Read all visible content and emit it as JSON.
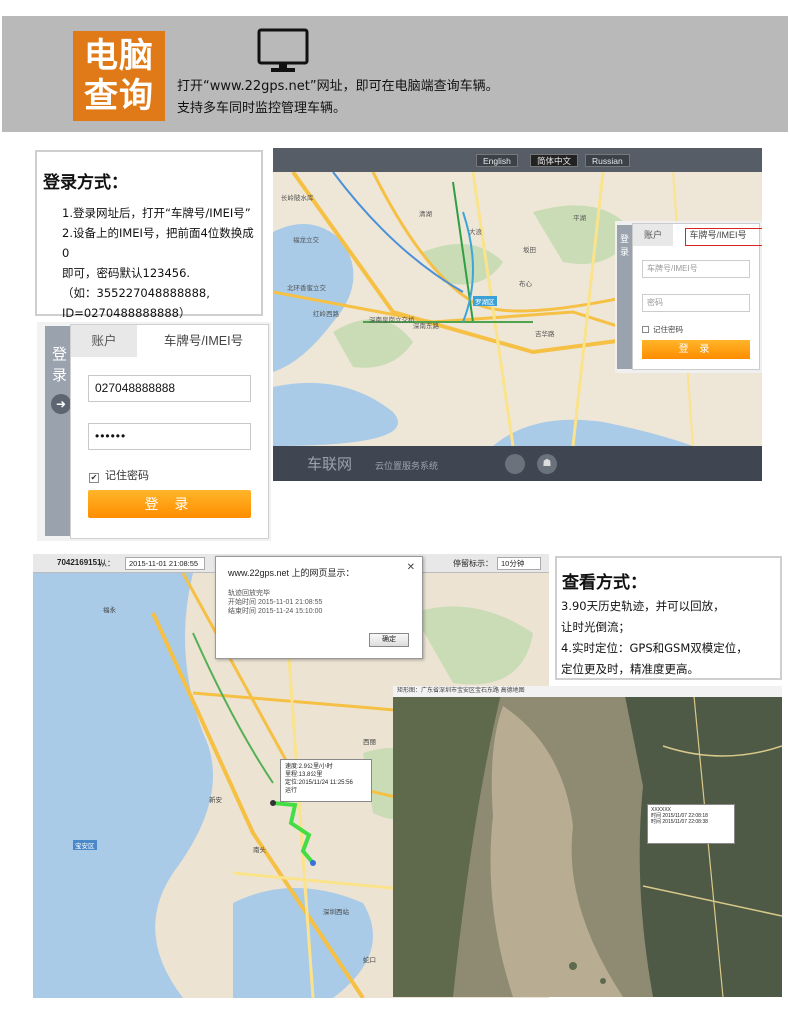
{
  "header": {
    "badge_line1": "电脑",
    "badge_line2": "查询",
    "line1": "打开“www.22gps.net”网址，即可在电脑端查询车辆。",
    "line2": "支持多车同时监控管理车辆。",
    "icon": "monitor-icon"
  },
  "login_section": {
    "title": "登录方式：",
    "line1": "1.登录网址后，打开“车牌号/IMEI号”",
    "line2": "2.设备上的IMEI号，把前面4位数换成0",
    "line3": "即可，密码默认123456.",
    "line4": "（如：355227048888888,",
    "line5": "ID=0270488888888）"
  },
  "login_form": {
    "side_label": "登录",
    "tab_account": "账户",
    "tab_plate": "车牌号/IMEI号",
    "id_value": "027048888888",
    "password_value": "••••••",
    "remember_label": "记住密码",
    "login_button": "登 录"
  },
  "map_site": {
    "lang_english": "English",
    "lang_chinese": "简体中文",
    "lang_russian": "Russian",
    "footer_logo": "车联网",
    "footer_sub": "云位置服务系统",
    "form": {
      "side_label": "登录",
      "tab_account": "账户",
      "tab_plate": "车牌号/IMEI号",
      "plate_placeholder": "车牌号/IMEI号",
      "password_placeholder": "密码",
      "remember_label": "记住密码",
      "login_button": "登 录"
    },
    "places": [
      "长岭陂水库",
      "福龙立交",
      "清湖",
      "大浪",
      "北环香蜜立交",
      "红岭西路",
      "深南皇岗立交桥",
      "深南东路",
      "罗湖区",
      "布心",
      "平湖",
      "坂田",
      "吉华路"
    ]
  },
  "view_section": {
    "title": "查看方式：",
    "line1": "3.90天历史轨迹，并可以回放，",
    "line2": "让时光倒流；",
    "line3": "4.实时定位：GPS和GSM双模定位，",
    "line4": "定位更及时，精准度更高。"
  },
  "track_map": {
    "device_id": "7042169151",
    "from_label": "从：",
    "from_value": "2015-11-01 21:08:55",
    "stop_label": "停留标示：",
    "stop_value": "10分钟",
    "dialog_title": "www.22gps.net 上的网页显示：",
    "dialog_line1": "轨迹回放完毕",
    "dialog_line2": "开始时间 2015-11-01 21:08:55",
    "dialog_line3": "结束时间 2015-11-24 15:10:00",
    "dialog_ok": "确定",
    "popup_line1": "速度:2.9公里/小时",
    "popup_line2": "里程:13.8公里",
    "popup_line3": "定位:2015/11/24 11:25:56",
    "popup_line4": "运行",
    "places": [
      "宝安区",
      "南头",
      "西丽",
      "深圳西站",
      "蛇口",
      "新安",
      "福永"
    ]
  },
  "satellite": {
    "bar_text": "矩形图：广东省深圳市宝安区宝石东路  高德地图",
    "popup_line1": "XXXXXX",
    "popup_line2": "时间 2015/11/07 22:08:18",
    "popup_line3": "时间 2015/11/07 22:08:38"
  },
  "colors": {
    "banner": "#b9b9b9",
    "badge": "#e07a18",
    "login_button": "#ff9a10",
    "nav_dark": "#565d67"
  }
}
